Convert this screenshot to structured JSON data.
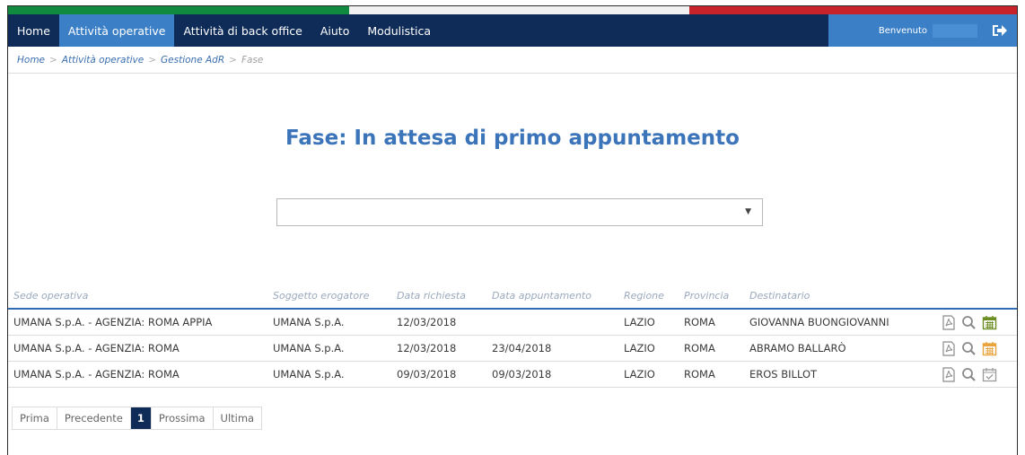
{
  "nav": {
    "items": [
      {
        "label": "Home",
        "active": false
      },
      {
        "label": "Attività operative",
        "active": true
      },
      {
        "label": "Attività di back office",
        "active": false
      },
      {
        "label": "Aiuto",
        "active": false
      },
      {
        "label": "Modulistica",
        "active": false
      }
    ],
    "welcome": "Benvenuto",
    "logout_icon": "logout-icon"
  },
  "breadcrumb": [
    "Home",
    "Attività operative",
    "Gestione AdR",
    "Fase"
  ],
  "page_title": "Fase: In attesa di primo appuntamento",
  "select": {
    "value": ""
  },
  "table": {
    "headers": [
      "Sede operativa",
      "Soggetto erogatore",
      "Data richiesta",
      "Data appuntamento",
      "Regione",
      "Provincia",
      "Destinatario"
    ],
    "rows": [
      {
        "sede": "UMANA S.p.A. - AGENZIA: ROMA APPIA",
        "soggetto": "UMANA S.p.A.",
        "data_richiesta": "12/03/2018",
        "data_appuntamento": "",
        "regione": "LAZIO",
        "provincia": "ROMA",
        "destinatario": "GIOVANNA BUONGIOVANNI",
        "calendar_color": "#6b8e23"
      },
      {
        "sede": "UMANA S.p.A. - AGENZIA: ROMA",
        "soggetto": "UMANA S.p.A.",
        "data_richiesta": "12/03/2018",
        "data_appuntamento": "23/04/2018",
        "regione": "LAZIO",
        "provincia": "ROMA",
        "destinatario": "ABRAMO BALLARÒ",
        "calendar_color": "#e8a33b"
      },
      {
        "sede": "UMANA S.p.A. - AGENZIA: ROMA",
        "soggetto": "UMANA S.p.A.",
        "data_richiesta": "09/03/2018",
        "data_appuntamento": "09/03/2018",
        "regione": "LAZIO",
        "provincia": "ROMA",
        "destinatario": "EROS BILLOT",
        "calendar_color": "#9a9a9a"
      }
    ]
  },
  "pager": {
    "first": "Prima",
    "prev": "Precedente",
    "current": "1",
    "next": "Prossima",
    "last": "Ultima"
  },
  "colors": {
    "nav_bg": "#0e2c57",
    "nav_active": "#3b7fc7",
    "title": "#3b74b9",
    "flag_green": "#0f8a3f",
    "flag_red": "#c8232b"
  }
}
